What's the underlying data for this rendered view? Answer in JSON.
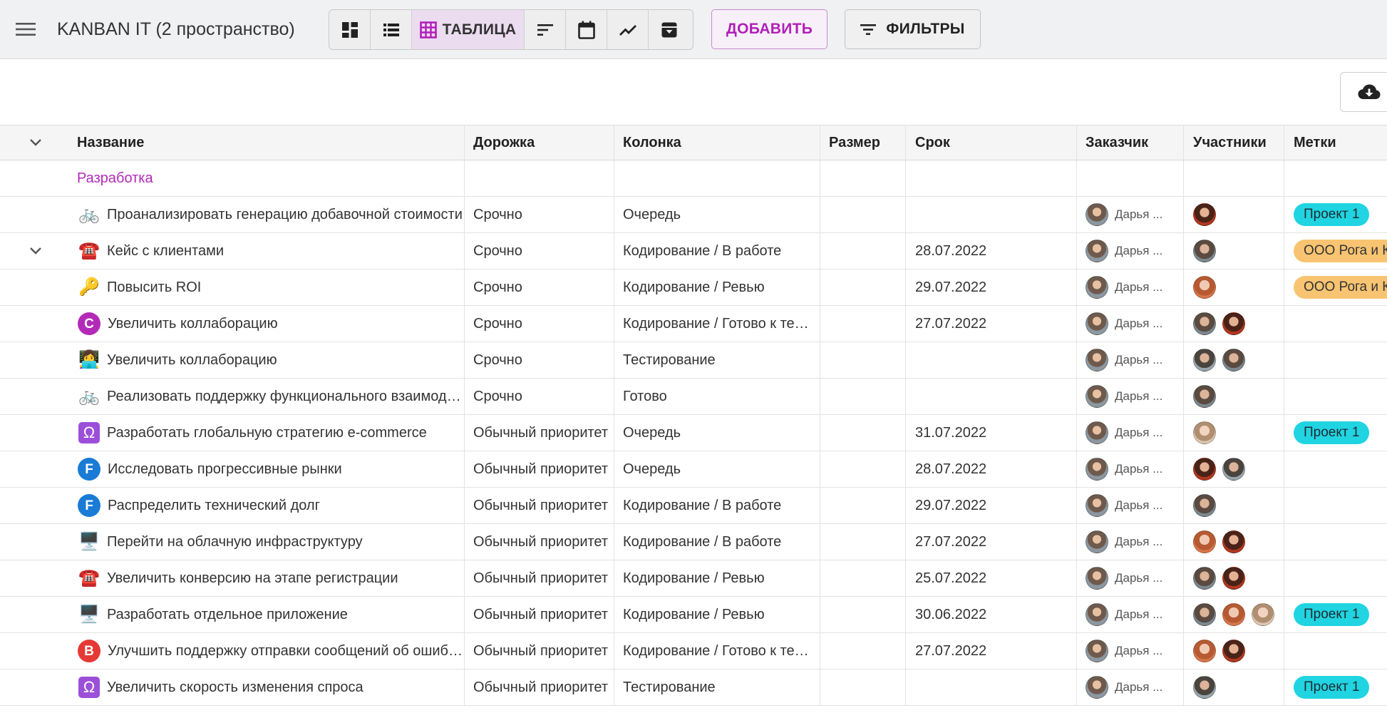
{
  "toolbar": {
    "board_title": "KANBAN IT (2 пространство)",
    "table_label": "ТАБЛИЦА",
    "add_label": "ДОБАВИТЬ",
    "filter_label": "ФИЛЬТРЫ",
    "views": [
      "board-view",
      "list-view",
      "table-view",
      "sort-view",
      "calendar-view",
      "chart-view",
      "archive-view"
    ],
    "active_view": "table-view",
    "colors": {
      "accent": "#b020b8",
      "active_bg": "#ecdcf0"
    }
  },
  "table": {
    "headers": {
      "name": "Название",
      "lane": "Дорожка",
      "column": "Колонка",
      "size": "Размер",
      "due": "Срок",
      "customer": "Заказчик",
      "participants": "Участники",
      "tags": "Метки"
    },
    "group": "Разработка",
    "rows": [
      {
        "icon": "bicycle-icon",
        "name": "Проанализировать генерацию добавочной стоимости",
        "lane": "Срочно",
        "column": "Очередь",
        "size": "",
        "due": "",
        "customer": "Дарья ...",
        "tag": "Проект 1"
      },
      {
        "icon": "telephone-icon",
        "name": "Кейс с клиентами",
        "lane": "Срочно",
        "column": "Кодирование / В работе",
        "size": "",
        "due": "28.07.2022",
        "customer": "Дарья ...",
        "tag": "ООО Рога и Копыта"
      },
      {
        "icon": "key-icon",
        "name": "Повысить ROI",
        "lane": "Срочно",
        "column": "Кодирование / Ревью",
        "size": "",
        "due": "29.07.2022",
        "customer": "Дарья ...",
        "tag": "ООО Рога и Копыта"
      },
      {
        "icon": "letter-c-icon",
        "letter": "C",
        "name": "Увеличить коллаборацию",
        "lane": "Срочно",
        "column": "Кодирование / Готово к тестированию",
        "size": "",
        "due": "27.07.2022",
        "customer": "Дарья ...",
        "tag": ""
      },
      {
        "icon": "person-laptop-icon",
        "name": "Увеличить коллаборацию",
        "lane": "Срочно",
        "column": "Тестирование",
        "size": "",
        "due": "",
        "customer": "Дарья ...",
        "tag": ""
      },
      {
        "icon": "bicycle-icon",
        "name": "Реализовать поддержку функционального взаимодействия",
        "lane": "Срочно",
        "column": "Готово",
        "size": "",
        "due": "",
        "customer": "Дарья ...",
        "tag": ""
      },
      {
        "icon": "omega-icon",
        "name": "Разработать глобальную стратегию e-commerce",
        "lane": "Обычный приоритет",
        "column": "Очередь",
        "size": "",
        "due": "31.07.2022",
        "customer": "Дарья ...",
        "tag": "Проект 1"
      },
      {
        "icon": "letter-f-icon",
        "letter": "F",
        "name": "Исследовать прогрессивные рынки",
        "lane": "Обычный приоритет",
        "column": "Очередь",
        "size": "",
        "due": "28.07.2022",
        "customer": "Дарья ...",
        "tag": ""
      },
      {
        "icon": "letter-f-icon",
        "letter": "F",
        "name": "Распределить технический долг",
        "lane": "Обычный приоритет",
        "column": "Кодирование / В работе",
        "size": "",
        "due": "29.07.2022",
        "customer": "Дарья ...",
        "tag": ""
      },
      {
        "icon": "computer-icon",
        "name": "Перейти на облачную инфраструктуру",
        "lane": "Обычный приоритет",
        "column": "Кодирование / В работе",
        "size": "",
        "due": "27.07.2022",
        "customer": "Дарья ...",
        "tag": ""
      },
      {
        "icon": "telephone-icon",
        "name": "Увеличить конверсию на этапе регистрации",
        "lane": "Обычный приоритет",
        "column": "Кодирование / Ревью",
        "size": "",
        "due": "25.07.2022",
        "customer": "Дарья ...",
        "tag": ""
      },
      {
        "icon": "computer-icon",
        "name": "Разработать отдельное приложение",
        "lane": "Обычный приоритет",
        "column": "Кодирование / Ревью",
        "size": "",
        "due": "30.06.2022",
        "customer": "Дарья ...",
        "tag": "Проект 1"
      },
      {
        "icon": "letter-b-icon",
        "letter": "B",
        "name": "Улучшить поддержку отправки сообщений об ошибках",
        "lane": "Обычный приоритет",
        "column": "Кодирование / Готово к тестированию",
        "size": "",
        "due": "27.07.2022",
        "customer": "Дарья ...",
        "tag": ""
      },
      {
        "icon": "omega-icon",
        "name": "Увеличить скорость изменения спроса",
        "lane": "Обычный приоритет",
        "column": "Тестирование",
        "size": "",
        "due": "",
        "customer": "Дарья ...",
        "tag": "Проект 1"
      }
    ]
  }
}
